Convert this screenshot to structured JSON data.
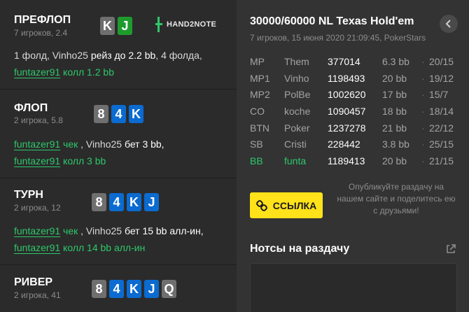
{
  "colors": {
    "accent": "#2ec86b",
    "button": "#ffe21a",
    "card_blue": "#0b6bd0",
    "card_green": "#1f9b2e",
    "card_grey": "#6f6f6f"
  },
  "preflop": {
    "name": "ПРЕФЛОП",
    "sub": "7 игроков, 2.4",
    "cards": [
      "K",
      "J"
    ],
    "action": {
      "t1": "1 фолд, Vinho25 ",
      "t2": "рейз до 2.2 bb",
      "t3": ", 4 фолда, ",
      "player": "funtazer91",
      "t4": " колл 1.2 bb"
    }
  },
  "logo": {
    "text": "HAND2NOTE"
  },
  "flop": {
    "name": "ФЛОП",
    "sub": "2 игрока, 5.8",
    "cards": [
      "8",
      "4",
      "K"
    ],
    "action": {
      "player1": "funtazer91",
      "t1": " чек ",
      "t2": ", Vinho25 ",
      "t3": "бет 3 bb,",
      "player2": "funtazer91",
      "t4": " колл 3 bb"
    }
  },
  "turn": {
    "name": "ТУРН",
    "sub": "2 игрока, 12",
    "cards": [
      "8",
      "4",
      "K",
      "J"
    ],
    "action": {
      "player1": "funtazer91",
      "t1": " чек ",
      "t2": ", Vinho25 ",
      "t3": "бет 15 bb алл-ин,",
      "player2": "funtazer91",
      "t4": " колл 14 bb алл-ин"
    }
  },
  "river": {
    "name": "РИВЕР",
    "sub": "2 игрока, 41",
    "cards": [
      "8",
      "4",
      "K",
      "J",
      "Q"
    ]
  },
  "hand": {
    "title": "30000/60000 NL Texas Hold'em",
    "sub": "7 игроков, 15 июня 2020 21:09:45, PokerStars",
    "back_icon": "chevron-left-icon",
    "players": [
      {
        "pos": "MP",
        "name": "Them",
        "id": "377014",
        "bb": "6.3 bb",
        "dot": "·",
        "stat": "20/15"
      },
      {
        "pos": "MP1",
        "name": "Vinho",
        "id": "1198493",
        "bb": "20 bb",
        "dot": "·",
        "stat": "19/12"
      },
      {
        "pos": "MP2",
        "name": "PolBe",
        "id": "1002620",
        "bb": "17 bb",
        "dot": "·",
        "stat": "15/7"
      },
      {
        "pos": "CO",
        "name": "koche",
        "id": "1090457",
        "bb": "18 bb",
        "dot": "·",
        "stat": "18/14"
      },
      {
        "pos": "BTN",
        "name": "Poker",
        "id": "1237278",
        "bb": "21 bb",
        "dot": "·",
        "stat": "22/12"
      },
      {
        "pos": "SB",
        "name": "Cristi",
        "id": "228442",
        "bb": "3.8 bb",
        "dot": "·",
        "stat": "25/15"
      },
      {
        "pos": "BB",
        "name": "funta",
        "id": "1189413",
        "bb": "20 bb",
        "dot": "·",
        "stat": "21/15"
      }
    ],
    "link_button": "ССЫЛКА",
    "link_icon": "link-icon",
    "publish_text": "Опубликуйте раздачу на нашем сайте и поделитесь ею с друзьями!",
    "notes_title": "Нотсы на раздачу",
    "notes_icon": "external-link-icon",
    "notes_value": ""
  }
}
